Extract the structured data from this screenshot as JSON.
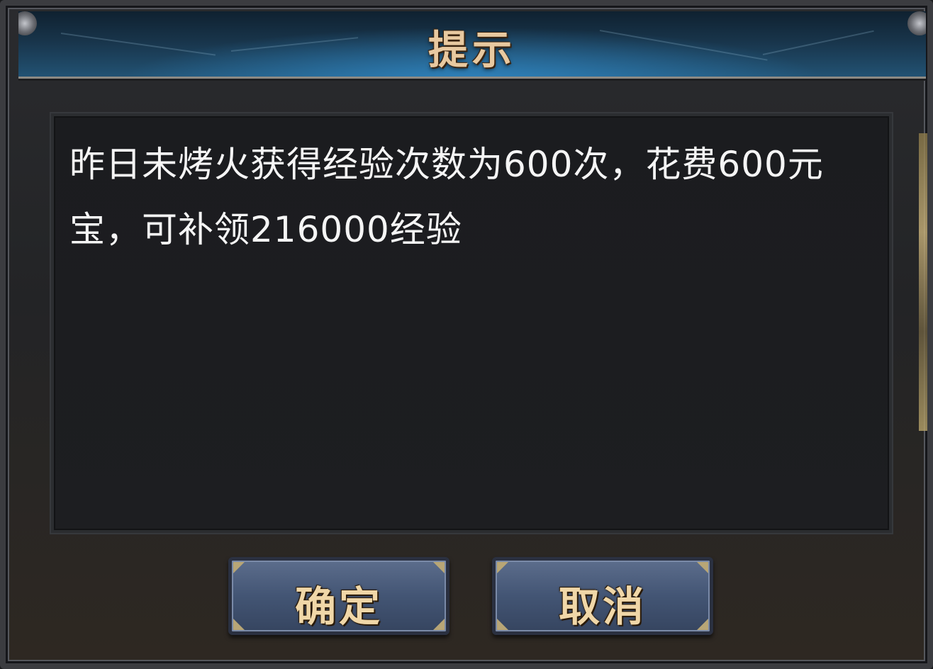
{
  "dialog": {
    "title": "提示",
    "message": "昨日未烤火获得经验次数为600次，花费600元宝，可补领216000经验",
    "confirm_label": "确定",
    "cancel_label": "取消"
  }
}
